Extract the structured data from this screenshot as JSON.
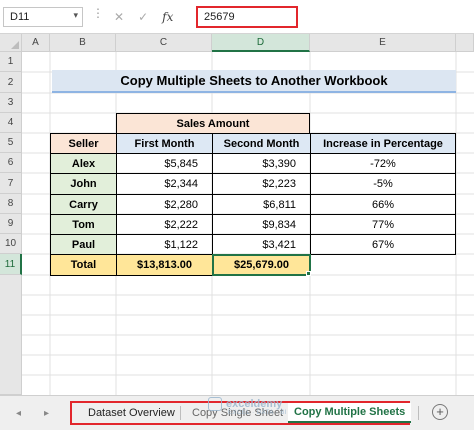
{
  "formula_bar": {
    "name_box": "D11",
    "formula_value": "25679",
    "fx_label": "fx",
    "cancel_glyph": "✕",
    "enter_glyph": "✓",
    "dropdown_glyph": "▾"
  },
  "columns": [
    "A",
    "B",
    "C",
    "D",
    "E"
  ],
  "rows": [
    "1",
    "2",
    "3",
    "4",
    "5",
    "6",
    "7",
    "8",
    "9",
    "10",
    "11"
  ],
  "sheet": {
    "title": "Copy Multiple Sheets to Another Workbook",
    "sales_amount_header": "Sales Amount",
    "headers": {
      "seller": "Seller",
      "first_month": "First Month",
      "second_month": "Second Month",
      "increase": "Increase in Percentage"
    },
    "data_rows": [
      {
        "seller": "Alex",
        "first": "$5,845",
        "second": "$3,390",
        "pct": "-72%"
      },
      {
        "seller": "John",
        "first": "$2,344",
        "second": "$2,223",
        "pct": "-5%"
      },
      {
        "seller": "Carry",
        "first": "$2,280",
        "second": "$6,811",
        "pct": "66%"
      },
      {
        "seller": "Tom",
        "first": "$2,222",
        "second": "$9,834",
        "pct": "77%"
      },
      {
        "seller": "Paul",
        "first": "$1,122",
        "second": "$3,421",
        "pct": "67%"
      }
    ],
    "total": {
      "label": "Total",
      "first": "$13,813.00",
      "second": "$25,679.00"
    }
  },
  "tabs": {
    "items": [
      "Dataset Overview",
      "Copy Single Sheet",
      "Copy Multiple Sheets"
    ],
    "active_index": 2,
    "nav_prev": "◂",
    "nav_next": "▸",
    "add_sheet": "+"
  },
  "watermark": {
    "text": "exceldemy",
    "subtitle": "EXCEL · DATA · BI"
  },
  "colors": {
    "excel_green": "#217346",
    "highlight_red": "#e2262c",
    "seller_fill": "#e2efda",
    "header_orange": "#fbe5d6",
    "header_blue": "#dde8f4",
    "total_fill": "#ffe699",
    "title_fill": "#dce6f2"
  }
}
